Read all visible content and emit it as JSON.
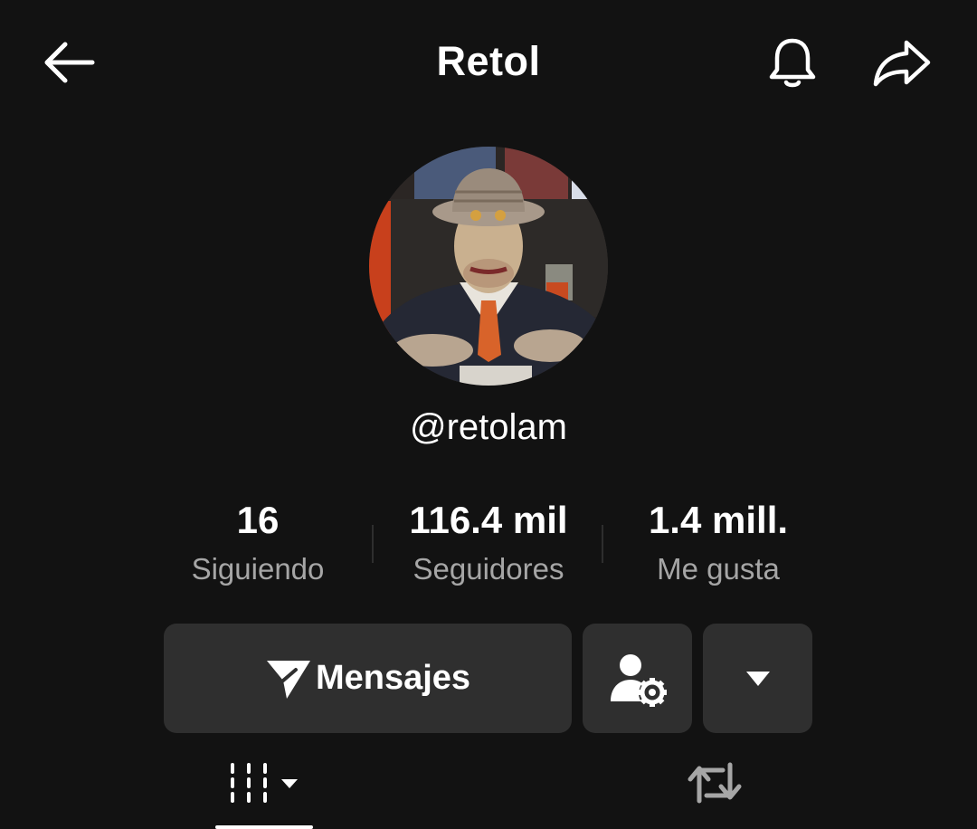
{
  "header": {
    "title": "Retol",
    "back_icon": "arrow-left-icon",
    "notification_icon": "bell-icon",
    "share_icon": "share-arrow-icon"
  },
  "profile": {
    "username": "@retolam",
    "avatar_description_icon": "avatar-image"
  },
  "stats": [
    {
      "value": "16",
      "label": "Siguiendo"
    },
    {
      "value": "116.4 mil",
      "label": "Seguidores"
    },
    {
      "value": "1.4 mill.",
      "label": "Me gusta"
    }
  ],
  "actions": {
    "messages_label": "Mensajes",
    "messages_icon": "paper-plane-icon",
    "friends_icon": "user-settings-icon",
    "more_icon": "caret-down-icon"
  },
  "tabs": [
    {
      "name": "videos",
      "icon": "grid-bars-icon",
      "active": true
    },
    {
      "name": "reposts",
      "icon": "repost-icon",
      "active": false
    }
  ],
  "colors": {
    "background": "#121212",
    "button_bg": "#2f2f2f",
    "text_primary": "#ffffff",
    "text_secondary": "#a6a6a6"
  }
}
